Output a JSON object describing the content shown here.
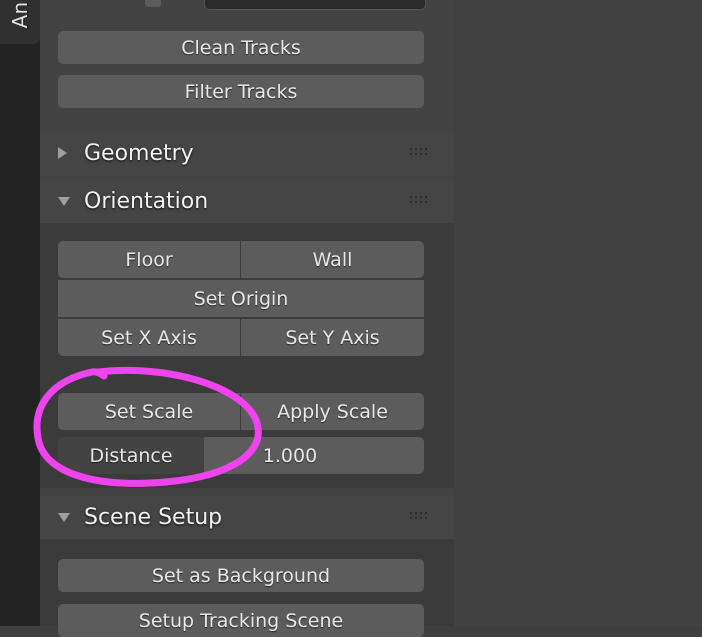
{
  "app": {
    "background_color": "#414141",
    "panel_color": "#434343",
    "button_color": "#5c5c5c",
    "text_color": "#e8e8e8",
    "annotation_color": "#ee44ee"
  },
  "rail": {
    "tab_label": "An"
  },
  "top_partial": {
    "checkbox_name": "checkbox",
    "field_name": "text-field"
  },
  "track_actions": {
    "clean_tracks_label": "Clean Tracks",
    "filter_tracks_label": "Filter Tracks"
  },
  "sections": {
    "geometry": {
      "title": "Geometry",
      "expanded": false,
      "arrow_icon": "triangle-right-icon",
      "grip_icon": "grip-dots-icon"
    },
    "orientation": {
      "title": "Orientation",
      "expanded": true,
      "arrow_icon": "triangle-down-icon",
      "grip_icon": "grip-dots-icon",
      "buttons": {
        "floor_label": "Floor",
        "wall_label": "Wall",
        "set_origin_label": "Set Origin",
        "set_x_axis_label": "Set X Axis",
        "set_y_axis_label": "Set Y Axis",
        "set_scale_label": "Set Scale",
        "apply_scale_label": "Apply Scale"
      },
      "distance": {
        "label": "Distance",
        "value": "1.000"
      }
    },
    "scene_setup": {
      "title": "Scene Setup",
      "expanded": true,
      "arrow_icon": "triangle-down-icon",
      "grip_icon": "grip-dots-icon",
      "buttons": {
        "set_as_background_label": "Set as Background",
        "setup_tracking_scene_label": "Setup Tracking Scene"
      }
    }
  },
  "annotation": {
    "shape": "hand-drawn-ellipse",
    "color": "#ee44ee",
    "encircles": [
      "Set Scale",
      "Distance"
    ]
  }
}
